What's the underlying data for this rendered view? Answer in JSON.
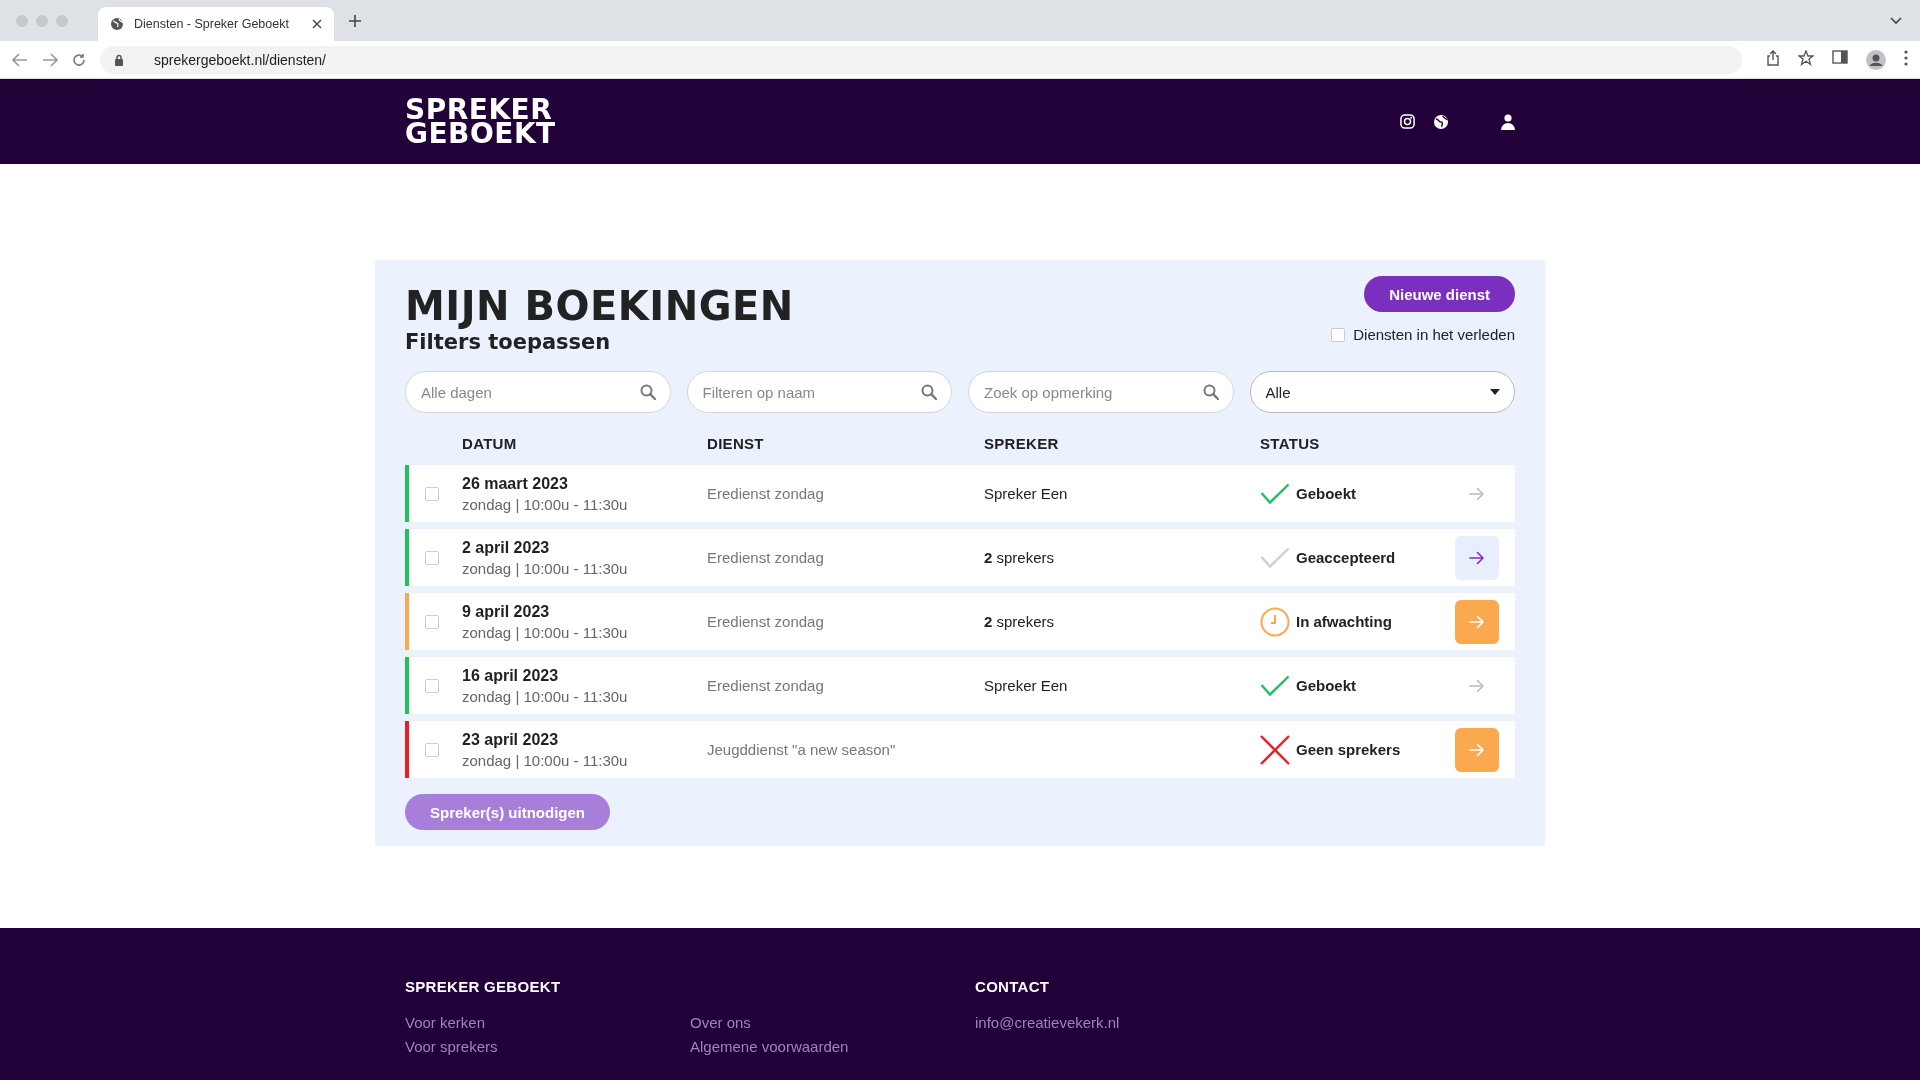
{
  "browser": {
    "tab_title": "Diensten - Spreker Geboekt",
    "url": "sprekergeboekt.nl/diensten/"
  },
  "header": {
    "logo_lines": [
      "SPREKER",
      "GEBOEKT"
    ]
  },
  "page": {
    "title": "MIJN BOEKINGEN",
    "subtitle": "Filters toepassen",
    "new_button": "Nieuwe dienst",
    "past_filter": {
      "label": "Diensten in het verleden",
      "checked": false
    },
    "filters": [
      {
        "placeholder": "Alle dagen"
      },
      {
        "placeholder": "Filteren op naam"
      },
      {
        "placeholder": "Zoek op opmerking"
      }
    ],
    "status_select": {
      "value": "Alle"
    },
    "columns": [
      "DATUM",
      "DIENST",
      "SPREKER",
      "STATUS"
    ],
    "rows": [
      {
        "date": "26 maart 2023",
        "time": "zondag | 10:00u - 11:30u",
        "dienst": "Eredienst zondag",
        "spreker": "Spreker Een",
        "status": {
          "text": "Geboekt",
          "kind": "booked"
        },
        "color": "#1fc15a",
        "checked": false,
        "action": {
          "kind": "plain"
        }
      },
      {
        "date": "2 april 2023",
        "time": "zondag | 10:00u - 11:30u",
        "dienst": "Eredienst zondag",
        "spreker": "**2** sprekers",
        "status": {
          "text": "Geaccepteerd",
          "kind": "accepted"
        },
        "color": "#1fc15a",
        "checked": false,
        "action": {
          "kind": "light"
        }
      },
      {
        "date": "9 april 2023",
        "time": "zondag | 10:00u - 11:30u",
        "dienst": "Eredienst zondag",
        "spreker": "**2** sprekers",
        "status": {
          "text": "In afwachting",
          "kind": "pending"
        },
        "color": "#fba94f",
        "checked": false,
        "action": {
          "kind": "orange"
        }
      },
      {
        "date": "16 april 2023",
        "time": "zondag | 10:00u - 11:30u",
        "dienst": "Eredienst zondag",
        "spreker": "Spreker Een",
        "status": {
          "text": "Geboekt",
          "kind": "booked"
        },
        "color": "#1fc15a",
        "checked": false,
        "action": {
          "kind": "plain"
        }
      },
      {
        "date": "23 april 2023",
        "time": "zondag | 10:00u - 11:30u",
        "dienst": "Jeugddienst \"a new season\"",
        "status": {
          "text": "Geen sprekers",
          "kind": "none"
        },
        "color": "#ee1c25",
        "checked": false,
        "action": {
          "kind": "orange"
        }
      }
    ],
    "invite_button": "Spreker(s) uitnodigen"
  },
  "footer": {
    "heading": "SPREKER GEBOEKT",
    "link_columns": [
      [
        "Voor kerken",
        "Voor sprekers"
      ],
      [
        "Over ons",
        "Algemene voorwaarden"
      ]
    ],
    "contact_heading": "CONTACT",
    "email": "info@creatievekerk.nl"
  }
}
